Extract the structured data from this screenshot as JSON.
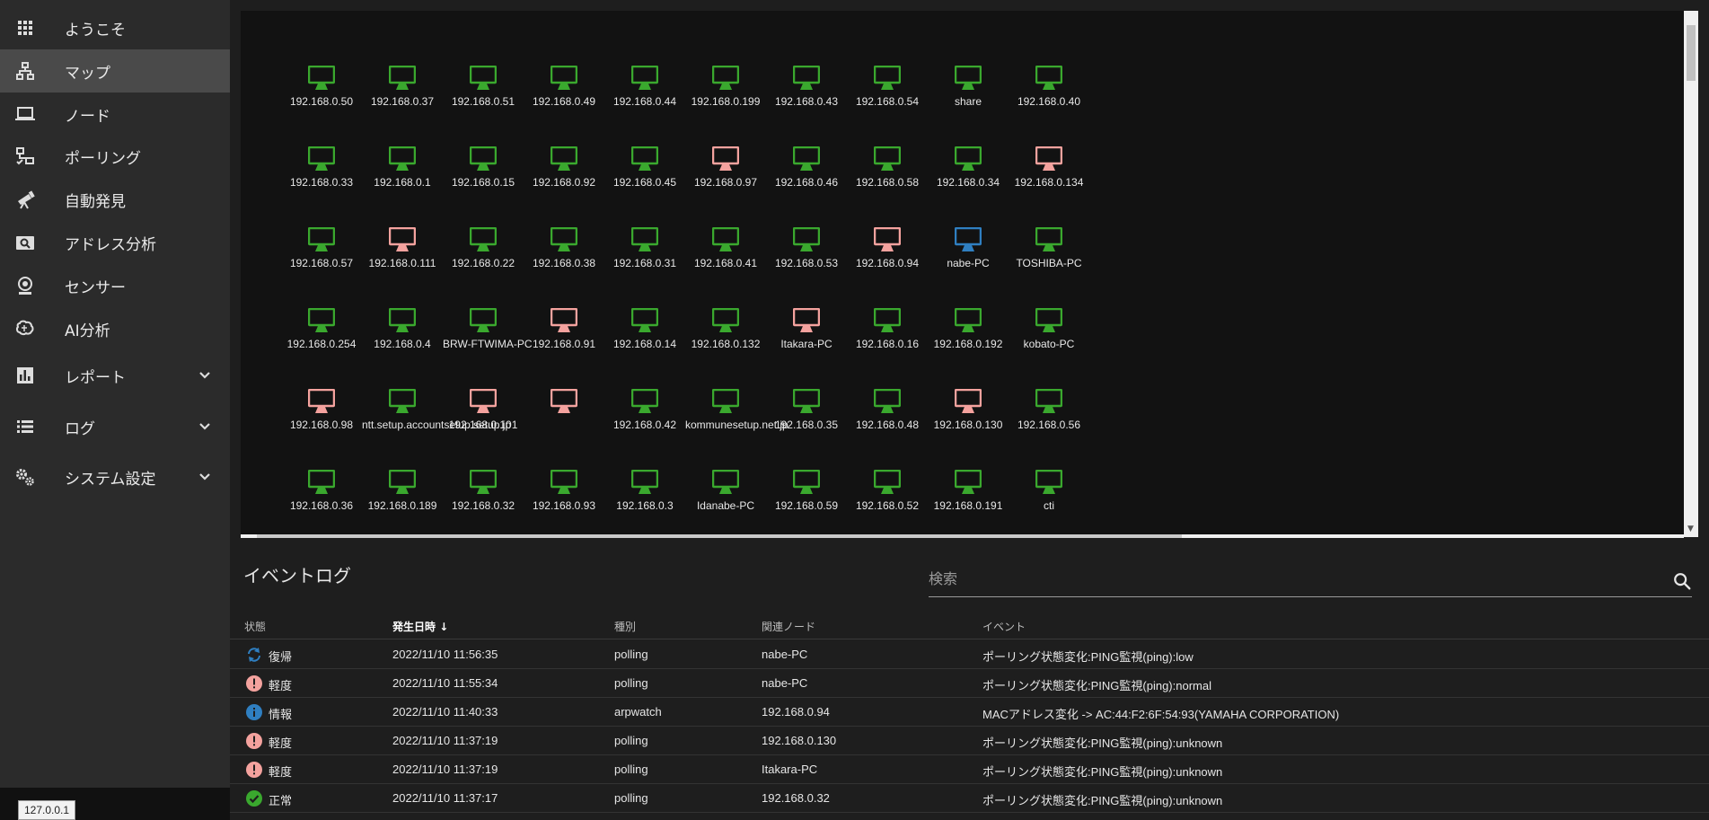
{
  "sidebar": {
    "items": [
      {
        "label": "ようこそ",
        "icon": "apps-grid-icon"
      },
      {
        "label": "マップ",
        "icon": "sitemap-icon"
      },
      {
        "label": "ノード",
        "icon": "laptop-icon"
      },
      {
        "label": "ポーリング",
        "icon": "polling-check-icon"
      },
      {
        "label": "自動発見",
        "icon": "telescope-icon"
      },
      {
        "label": "アドレス分析",
        "icon": "address-search-icon"
      },
      {
        "label": "センサー",
        "icon": "webcam-icon"
      },
      {
        "label": "AI分析",
        "icon": "brain-icon"
      },
      {
        "label": "レポート",
        "icon": "chart-icon"
      },
      {
        "label": "ログ",
        "icon": "list-icon"
      },
      {
        "label": "システム設定",
        "icon": "cogs-icon"
      }
    ],
    "host_chip": "127.0.0.1"
  },
  "colors": {
    "ok": "#3aa82e",
    "warn": "#f4a29e",
    "info": "#2f7fc1",
    "active_nav": "#4a4a4a"
  },
  "map": {
    "nodes": [
      [
        {
          "label": "192.168.0.50",
          "status": "ok"
        },
        {
          "label": "192.168.0.37",
          "status": "ok"
        },
        {
          "label": "192.168.0.51",
          "status": "ok"
        },
        {
          "label": "192.168.0.49",
          "status": "ok"
        },
        {
          "label": "192.168.0.44",
          "status": "ok"
        },
        {
          "label": "192.168.0.199",
          "status": "ok"
        },
        {
          "label": "192.168.0.43",
          "status": "ok"
        },
        {
          "label": "192.168.0.54",
          "status": "ok"
        },
        {
          "label": "share",
          "status": "ok"
        },
        {
          "label": "192.168.0.40",
          "status": "ok"
        }
      ],
      [
        {
          "label": "192.168.0.33",
          "status": "ok"
        },
        {
          "label": "192.168.0.1",
          "status": "ok"
        },
        {
          "label": "192.168.0.15",
          "status": "ok"
        },
        {
          "label": "192.168.0.92",
          "status": "ok"
        },
        {
          "label": "192.168.0.45",
          "status": "ok"
        },
        {
          "label": "192.168.0.97",
          "status": "warn"
        },
        {
          "label": "192.168.0.46",
          "status": "ok"
        },
        {
          "label": "192.168.0.58",
          "status": "ok"
        },
        {
          "label": "192.168.0.34",
          "status": "ok"
        },
        {
          "label": "192.168.0.134",
          "status": "warn"
        }
      ],
      [
        {
          "label": "192.168.0.57",
          "status": "ok"
        },
        {
          "label": "192.168.0.111",
          "status": "warn"
        },
        {
          "label": "192.168.0.22",
          "status": "ok"
        },
        {
          "label": "192.168.0.38",
          "status": "ok"
        },
        {
          "label": "192.168.0.31",
          "status": "ok"
        },
        {
          "label": "192.168.0.41",
          "status": "ok"
        },
        {
          "label": "192.168.0.53",
          "status": "ok"
        },
        {
          "label": "192.168.0.94",
          "status": "warn"
        },
        {
          "label": "nabe-PC",
          "status": "info"
        },
        {
          "label": "TOSHIBA-PC",
          "status": "ok"
        }
      ],
      [
        {
          "label": "192.168.0.254",
          "status": "ok"
        },
        {
          "label": "192.168.0.4",
          "status": "ok"
        },
        {
          "label": "BRW-FTWIMA-PC",
          "status": "ok"
        },
        {
          "label": "192.168.0.91",
          "status": "warn"
        },
        {
          "label": "192.168.0.14",
          "status": "ok"
        },
        {
          "label": "192.168.0.132",
          "status": "ok"
        },
        {
          "label": "Itakara-PC",
          "status": "warn"
        },
        {
          "label": "192.168.0.16",
          "status": "ok"
        },
        {
          "label": "192.168.0.192",
          "status": "ok"
        },
        {
          "label": "kobato-PC",
          "status": "ok"
        }
      ],
      [
        {
          "label": "192.168.0.98",
          "status": "warn"
        },
        {
          "label": "ntt.setup.accountsetup.setup.jp",
          "status": "ok"
        },
        {
          "label": "192.168.0.101",
          "status": "warn"
        },
        {
          "label": "",
          "status": "warn"
        },
        {
          "label": "192.168.0.42",
          "status": "ok"
        },
        {
          "label": "kommunesetup.net.jp",
          "status": "ok"
        },
        {
          "label": "192.168.0.35",
          "status": "ok"
        },
        {
          "label": "192.168.0.48",
          "status": "ok"
        },
        {
          "label": "192.168.0.130",
          "status": "warn"
        },
        {
          "label": "192.168.0.56",
          "status": "ok"
        }
      ],
      [
        {
          "label": "192.168.0.36",
          "status": "ok"
        },
        {
          "label": "192.168.0.189",
          "status": "ok"
        },
        {
          "label": "192.168.0.32",
          "status": "ok"
        },
        {
          "label": "192.168.0.93",
          "status": "ok"
        },
        {
          "label": "192.168.0.3",
          "status": "ok"
        },
        {
          "label": "Idanabe-PC",
          "status": "ok"
        },
        {
          "label": "192.168.0.59",
          "status": "ok"
        },
        {
          "label": "192.168.0.52",
          "status": "ok"
        },
        {
          "label": "192.168.0.191",
          "status": "ok"
        },
        {
          "label": "cti",
          "status": "ok"
        }
      ]
    ]
  },
  "event_log": {
    "title": "イベントログ",
    "search_placeholder": "検索",
    "headers": {
      "status": "状態",
      "datetime": "発生日時",
      "type": "種別",
      "node": "関連ノード",
      "event": "イベント"
    },
    "rows": [
      {
        "status": "復帰",
        "status_kind": "recover",
        "datetime": "2022/11/10 11:56:35",
        "type": "polling",
        "node": "nabe-PC",
        "event": "ポーリング状態変化:PING監視(ping):low"
      },
      {
        "status": "軽度",
        "status_kind": "warn",
        "datetime": "2022/11/10 11:55:34",
        "type": "polling",
        "node": "nabe-PC",
        "event": "ポーリング状態変化:PING監視(ping):normal"
      },
      {
        "status": "情報",
        "status_kind": "info",
        "datetime": "2022/11/10 11:40:33",
        "type": "arpwatch",
        "node": "192.168.0.94",
        "event": "MACアドレス変化 -> AC:44:F2:6F:54:93(YAMAHA CORPORATION)"
      },
      {
        "status": "軽度",
        "status_kind": "warn",
        "datetime": "2022/11/10 11:37:19",
        "type": "polling",
        "node": "192.168.0.130",
        "event": "ポーリング状態変化:PING監視(ping):unknown"
      },
      {
        "status": "軽度",
        "status_kind": "warn",
        "datetime": "2022/11/10 11:37:19",
        "type": "polling",
        "node": "Itakara-PC",
        "event": "ポーリング状態変化:PING監視(ping):unknown"
      },
      {
        "status": "正常",
        "status_kind": "ok",
        "datetime": "2022/11/10 11:37:17",
        "type": "polling",
        "node": "192.168.0.32",
        "event": "ポーリング状態変化:PING監視(ping):unknown"
      }
    ]
  }
}
